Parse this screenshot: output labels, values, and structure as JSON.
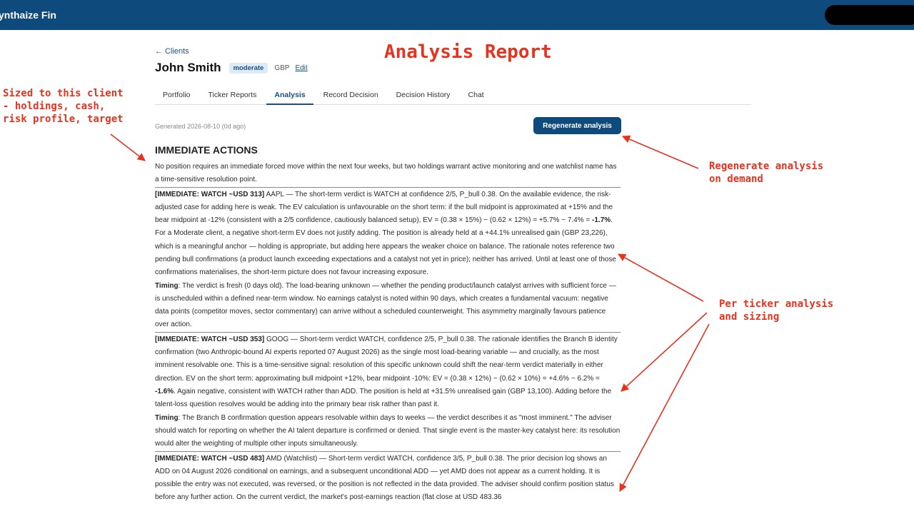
{
  "app": {
    "brand": "ynthaize Fin"
  },
  "nav": {
    "back_label": "← Clients"
  },
  "client": {
    "name": "John Smith",
    "risk_profile": "moderate",
    "currency": "GBP",
    "edit_label": "Edit"
  },
  "tabs": [
    {
      "label": "Portfolio",
      "active": false
    },
    {
      "label": "Ticker Reports",
      "active": false
    },
    {
      "label": "Analysis",
      "active": true
    },
    {
      "label": "Record Decision",
      "active": false
    },
    {
      "label": "Decision History",
      "active": false
    },
    {
      "label": "Chat",
      "active": false
    }
  ],
  "analysis": {
    "generated": "Generated 2026-08-10 (0d ago)",
    "regenerate_label": "Regenerate analysis",
    "section_title": "IMMEDIATE ACTIONS",
    "intro": "No position requires an immediate forced move within the next four weeks, but two holdings warrant active monitoring and one watchlist name has a time-sensitive resolution point.",
    "blocks": [
      {
        "tag": "[IMMEDIATE: WATCH ~USD 313]",
        "body_a": " AAPL — The short-term verdict is WATCH at confidence 2/5, P_bull 0.38. On the available evidence, the risk-adjusted case for adding here is weak. The EV calculation is unfavourable on the short term: if the bull midpoint is approximated at +15% and the bear midpoint at -12% (consistent with a 2/5 confidence, cautiously balanced setup), EV = (0.38 × 15%) − (0.62 × 12%) = +5.7% − 7.4% = ",
        "bold_value": "-1.7%",
        "body_b": ". For a Moderate client, a negative short-term EV does not justify adding. The position is already held at a +44.1% unrealised gain (GBP 23,226), which is a meaningful anchor — holding is appropriate, but adding here appears the weaker choice on balance. The rationale notes reference two pending bull confirmations (a product launch exceeding expectations and a catalyst not yet in price); neither has arrived. Until at least one of those confirmations materialises, the short-term picture does not favour increasing exposure.",
        "timing_label": "Timing",
        "timing_text": ": The verdict is fresh (0 days old). The load-bearing unknown — whether the pending product/launch catalyst arrives with sufficient force — is unscheduled within a defined near-term window. No earnings catalyst is noted within 90 days, which creates a fundamental vacuum: negative data points (competitor moves, sector commentary) can arrive without a scheduled counterweight. This asymmetry marginally favours patience over action."
      },
      {
        "tag": "[IMMEDIATE: WATCH ~USD 353]",
        "body_a": " GOOG — Short-term verdict WATCH, confidence 2/5, P_bull 0.38. The rationale identifies the Branch B identity confirmation (two Anthropic-bound AI experts reported 07 August 2026) as the single most load-bearing variable — and crucially, as the most imminent resolvable one. This is a time-sensitive signal: resolution of this specific unknown could shift the near-term verdict materially in either direction. EV on the short term: approximating bull midpoint +12%, bear midpoint -10%: EV = (0.38 × 12%) − (0.62 × 10%) = +4.6% − 6.2% = ",
        "bold_value": "-1.6%",
        "body_b": ". Again negative, consistent with WATCH rather than ADD. The position is held at +31.5% unrealised gain (GBP 13,100). Adding before the talent-loss question resolves would be adding into the primary bear risk rather than past it.",
        "timing_label": "Timing",
        "timing_text": ": The Branch B confirmation question appears resolvable within days to weeks — the verdict describes it as \"most imminent.\" The adviser should watch for reporting on whether the AI talent departure is confirmed or denied. That single event is the master-key catalyst here: its resolution would alter the weighting of multiple other inputs simultaneously."
      },
      {
        "tag": "[IMMEDIATE: WATCH ~USD 483]",
        "body_a": " AMD (Watchlist) — Short-term verdict WATCH, confidence 3/5, P_bull 0.38. The prior decision log shows an ADD on 04 August 2026 conditional on earnings, and a subsequent unconditional ADD — yet AMD does not appear as a current holding. It is possible the entry was not executed, was reversed, or the position is not reflected in the data provided. The adviser should confirm position status before any further action. On the current verdict, the market's post-earnings reaction (flat close at USD 483.36",
        "bold_value": "",
        "body_b": "",
        "timing_label": "",
        "timing_text": ""
      }
    ]
  },
  "annotations": {
    "title": "Analysis Report",
    "client_note": "Sized to this client\n- holdings, cash,\nrisk profile, target",
    "regen_note": "Regenerate analysis\non demand",
    "ticker_note": "Per ticker analysis\nand sizing",
    "color": "#e8321e"
  }
}
